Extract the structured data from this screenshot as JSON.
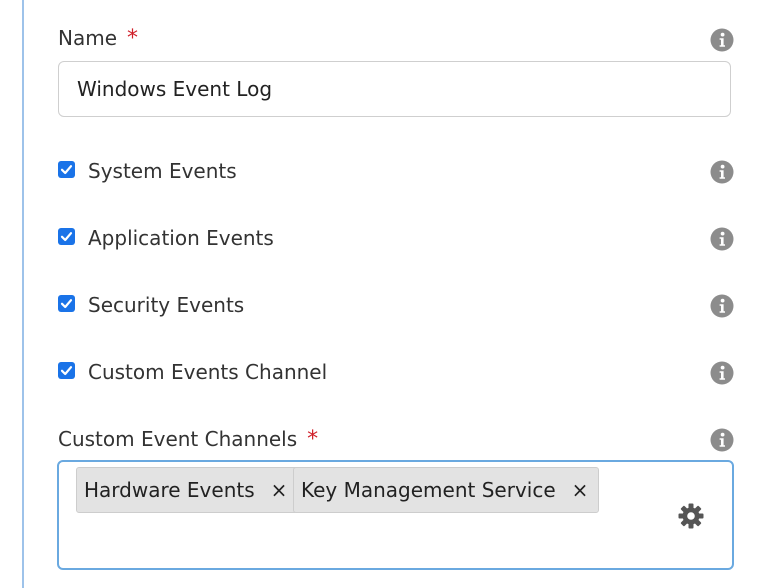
{
  "name_field": {
    "label": "Name",
    "required_marker": "*",
    "value": "Windows Event Log"
  },
  "checkboxes": [
    {
      "label": "System Events",
      "checked": true
    },
    {
      "label": "Application Events",
      "checked": true
    },
    {
      "label": "Security Events",
      "checked": true
    },
    {
      "label": "Custom Events Channel",
      "checked": true
    }
  ],
  "custom_channels": {
    "label": "Custom Event Channels",
    "required_marker": "*",
    "tags": [
      {
        "label": "Hardware Events",
        "remove": "×"
      },
      {
        "label": "Key Management Service",
        "remove": "×"
      }
    ]
  },
  "icons": {
    "info": "info-icon",
    "settings": "gear-icon",
    "remove": "close-icon"
  },
  "colors": {
    "accent": "#1a73e8",
    "required": "#d0202a",
    "info_icon": "#8c8c8c",
    "focus_border": "#6aa9e0",
    "tag_bg": "#e3e3e3"
  }
}
